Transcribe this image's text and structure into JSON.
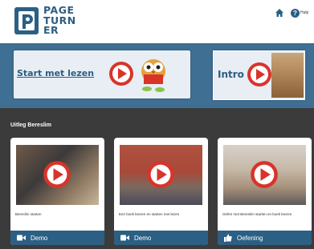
{
  "header": {
    "logo_lines": [
      "PAGE",
      "TURN",
      "ER"
    ],
    "help_label": "Hulp"
  },
  "hero": {
    "start_label": "Start met lezen",
    "intro_label": "Intro"
  },
  "section": {
    "title": "Uitleg Bereslim",
    "videos": [
      {
        "caption": "Bereslim starten",
        "footer": "Demo",
        "footer_icon": "video-camera-icon"
      },
      {
        "caption": "Een boek kiezen en starten met lezen",
        "footer": "Demo",
        "footer_icon": "video-camera-icon"
      },
      {
        "caption": "Oefen met Bereslim starten en boek kiezen",
        "footer": "Oefening",
        "footer_icon": "thumbs-up-icon"
      }
    ]
  },
  "colors": {
    "brand_blue": "#2b5f84",
    "banner_blue": "#3f6f92",
    "play_red": "#d8342a",
    "section_bg": "#3b3b3b"
  }
}
